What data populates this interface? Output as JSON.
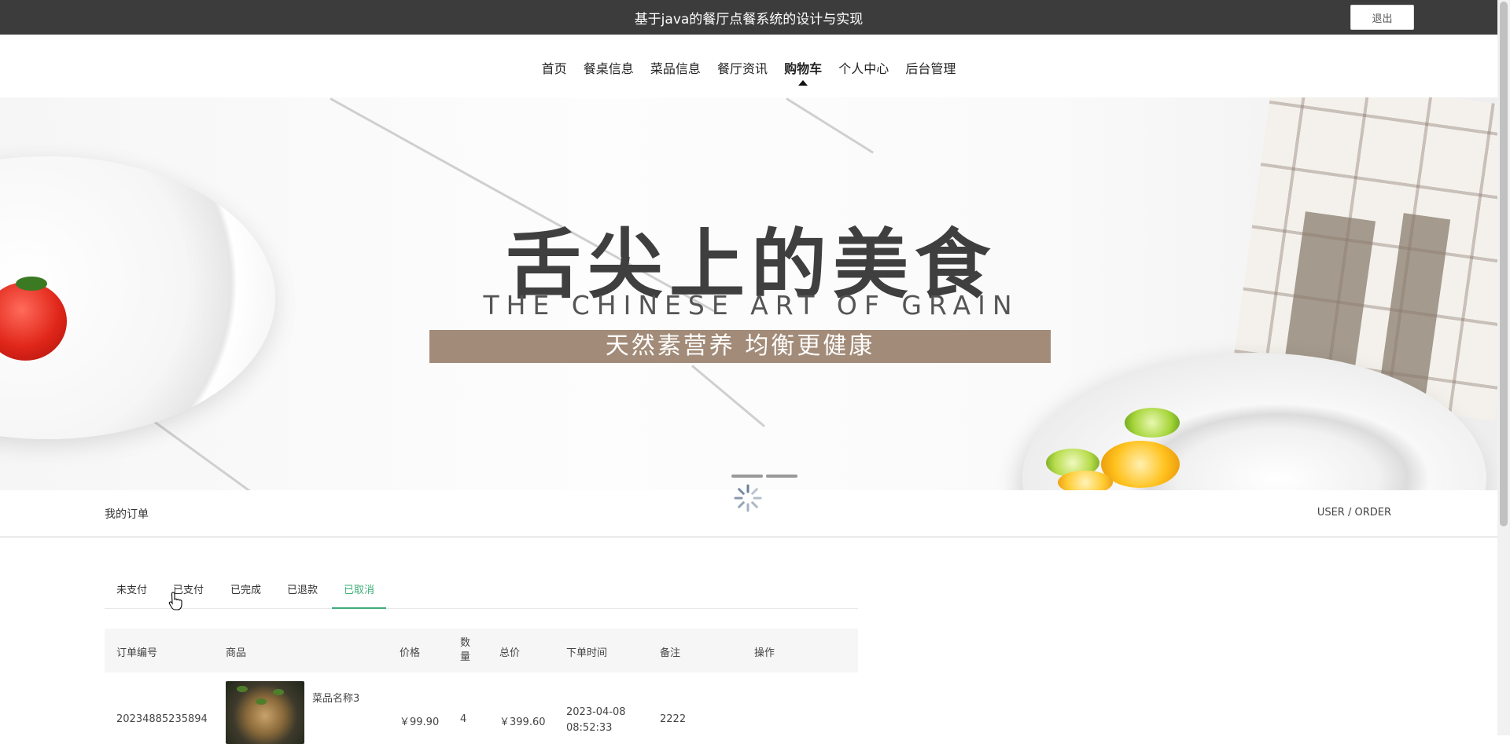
{
  "header": {
    "title": "基于java的餐厅点餐系统的设计与实现",
    "logout_label": "退出"
  },
  "nav": {
    "items": [
      {
        "label": "首页"
      },
      {
        "label": "餐桌信息"
      },
      {
        "label": "菜品信息"
      },
      {
        "label": "餐厅资讯"
      },
      {
        "label": "购物车",
        "active": true
      },
      {
        "label": "个人中心"
      },
      {
        "label": "后台管理"
      }
    ]
  },
  "banner": {
    "headline": "舌尖上的美食",
    "subline": "THE CHINESE ART OF GRAIN",
    "ribbon": "天然素营养 均衡更健康",
    "slide_count": 2
  },
  "section": {
    "title": "我的订单",
    "breadcrumb": "USER / ORDER"
  },
  "tabs": [
    {
      "label": "未支付"
    },
    {
      "label": "已支付"
    },
    {
      "label": "已完成"
    },
    {
      "label": "已退款"
    },
    {
      "label": "已取消",
      "active": true
    }
  ],
  "table": {
    "columns": [
      "订单编号",
      "商品",
      "价格",
      "数量",
      "总价",
      "下单时间",
      "备注",
      "操作"
    ],
    "rows": [
      {
        "order_no": "20234885235894",
        "product_name": "菜品名称3",
        "price": "￥99.90",
        "quantity": "4",
        "total": "￥399.60",
        "date": "2023-04-08",
        "time": "08:52:33",
        "note": "2222"
      }
    ]
  },
  "colors": {
    "topbar": "#3c3c3c",
    "accent": "#3fae7a",
    "ribbon": "#a28b78"
  }
}
